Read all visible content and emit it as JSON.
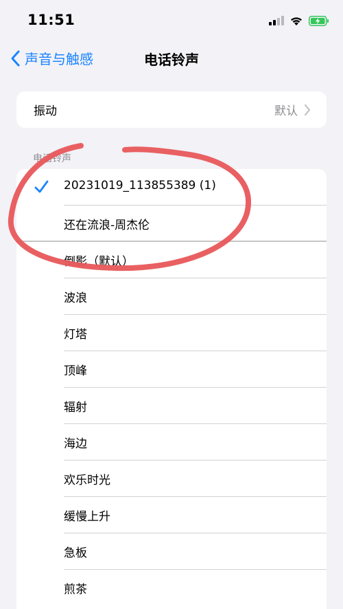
{
  "status_bar": {
    "time": "11:51",
    "icons": [
      "cellular-signal-icon",
      "wifi-icon",
      "battery-charging-icon"
    ]
  },
  "nav": {
    "back_label": "声音与触感",
    "title": "电话铃声"
  },
  "vibration": {
    "label": "振动",
    "value": "默认"
  },
  "ringtones": {
    "section_header": "电话铃声",
    "items": [
      {
        "label": "20231019_113855389 (1)",
        "selected": true
      },
      {
        "label": "还在流浪-周杰伦",
        "selected": false
      },
      {
        "label": "倒影（默认）",
        "selected": false
      },
      {
        "label": "波浪",
        "selected": false
      },
      {
        "label": "灯塔",
        "selected": false
      },
      {
        "label": "顶峰",
        "selected": false
      },
      {
        "label": "辐射",
        "selected": false
      },
      {
        "label": "海边",
        "selected": false
      },
      {
        "label": "欢乐时光",
        "selected": false
      },
      {
        "label": "缓慢上升",
        "selected": false
      },
      {
        "label": "急板",
        "selected": false
      },
      {
        "label": "煎茶",
        "selected": false
      }
    ]
  },
  "colors": {
    "accent": "#1a84ff",
    "annotation": "#e8575a",
    "background": "#f2f2f7",
    "secondary_text": "#8e8e93"
  }
}
